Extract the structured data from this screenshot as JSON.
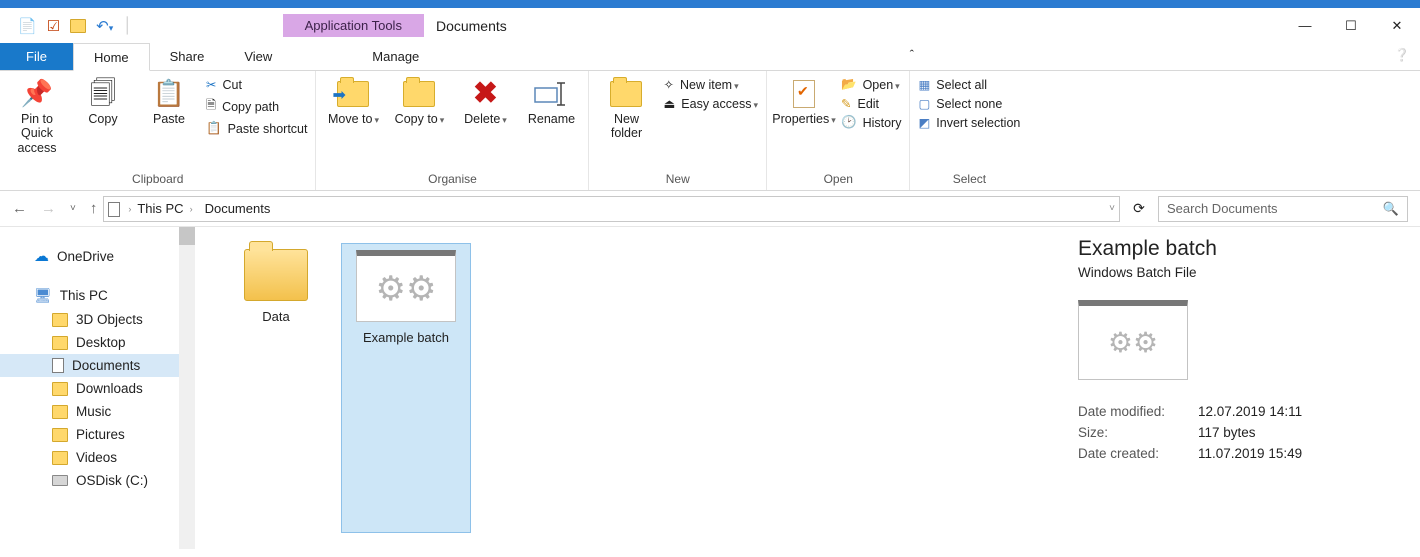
{
  "titlebar": {
    "contextTab": "Application Tools",
    "title": "Documents"
  },
  "tabs": {
    "file": "File",
    "home": "Home",
    "share": "Share",
    "view": "View",
    "manage": "Manage"
  },
  "ribbon": {
    "clipboard": {
      "label": "Clipboard",
      "pin": "Pin to Quick access",
      "copy": "Copy",
      "paste": "Paste",
      "cut": "Cut",
      "copyPath": "Copy path",
      "pasteShortcut": "Paste shortcut"
    },
    "organise": {
      "label": "Organise",
      "moveTo": "Move to",
      "copyTo": "Copy to",
      "delete": "Delete",
      "rename": "Rename"
    },
    "new": {
      "label": "New",
      "newFolder": "New folder",
      "newItem": "New item",
      "easyAccess": "Easy access"
    },
    "open": {
      "label": "Open",
      "properties": "Properties",
      "open": "Open",
      "edit": "Edit",
      "history": "History"
    },
    "select": {
      "label": "Select",
      "selectAll": "Select all",
      "selectNone": "Select none",
      "invert": "Invert selection"
    }
  },
  "address": {
    "root": "This PC",
    "folder": "Documents",
    "searchPlaceholder": "Search Documents"
  },
  "nav": {
    "onedrive": "OneDrive",
    "thispc": "This PC",
    "items": [
      "3D Objects",
      "Desktop",
      "Documents",
      "Downloads",
      "Music",
      "Pictures",
      "Videos",
      "OSDisk (C:)"
    ]
  },
  "files": [
    {
      "name": "Data",
      "type": "folder"
    },
    {
      "name": "Example batch",
      "type": "batch",
      "selected": true
    }
  ],
  "details": {
    "name": "Example batch",
    "type": "Windows Batch File",
    "props": [
      {
        "k": "Date modified:",
        "v": "12.07.2019 14:11"
      },
      {
        "k": "Size:",
        "v": "117 bytes"
      },
      {
        "k": "Date created:",
        "v": "11.07.2019 15:49"
      }
    ]
  }
}
